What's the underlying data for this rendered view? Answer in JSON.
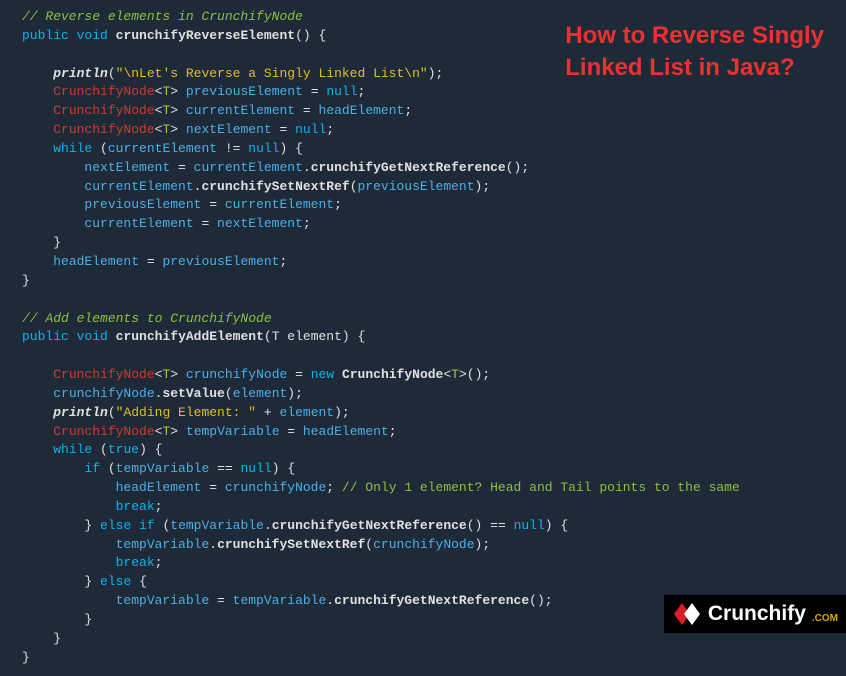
{
  "overlay": {
    "title_line1": "How to Reverse Singly",
    "title_line2": "Linked List in Java?"
  },
  "logo": {
    "text": "Crunchify",
    "ext": ".COM"
  },
  "tokens": {
    "cmt_reverse": "// Reverse elements in CrunchifyNode",
    "kw_public": "public",
    "kw_void": "void",
    "m_reverse": "crunchifyReverseElement",
    "open_call": "()",
    "lbrace": " {",
    "println": "println",
    "str_reverse": "\"\\nLet's Reverse a Singly Linked List\\n\"",
    "semi": ";",
    "type_cn": "CrunchifyNode",
    "gen_open": "<",
    "gen_t": "T",
    "gen_close": ">",
    "id_prev": "previousElement",
    "id_curr": "currentElement",
    "id_next": "nextElement",
    "id_head": "headElement",
    "eq": " = ",
    "kw_null": "null",
    "kw_while": "while",
    "cond_notnull_open": " (",
    "op_neq": " != ",
    "cond_close": ")",
    "m_getNext": "crunchifyGetNextReference",
    "m_setNext": "crunchifySetNextRef",
    "rbrace": "}",
    "cmt_add": "// Add elements to CrunchifyNode",
    "m_add": "crunchifyAddElement",
    "param_add": "(T element)",
    "id_crunchifyNode": "crunchifyNode",
    "kw_new": "new",
    "m_ctor_suffix": "()",
    "m_setValue": "setValue",
    "id_element": "element",
    "str_adding": "\"Adding Element: \"",
    "op_plus": " + ",
    "id_temp": "tempVariable",
    "kw_true": "true",
    "kw_if": "if",
    "op_eqeq": " == ",
    "cmt_only1": "// Only 1 element? Head and Tail points to the same",
    "kw_break": "break",
    "kw_elseif": "else if",
    "kw_else": "else",
    "dot": "."
  }
}
